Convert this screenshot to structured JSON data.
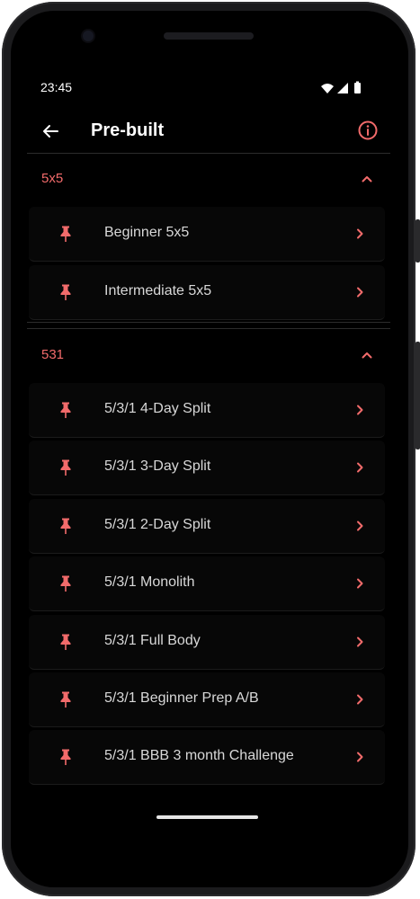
{
  "status": {
    "time": "23:45"
  },
  "appbar": {
    "title": "Pre-built"
  },
  "colors": {
    "accent": "#f26b6b",
    "background": "#000000",
    "text": "#d8d8d8"
  },
  "icons": {
    "back": "arrow-left-icon",
    "info": "info-icon",
    "pin": "pin-icon",
    "expand": "chevron-up-icon",
    "open": "chevron-right-icon"
  },
  "sections": [
    {
      "title": "5x5",
      "items": [
        {
          "label": "Beginner 5x5"
        },
        {
          "label": "Intermediate 5x5"
        }
      ]
    },
    {
      "title": "531",
      "items": [
        {
          "label": "5/3/1 4-Day Split"
        },
        {
          "label": "5/3/1 3-Day Split"
        },
        {
          "label": "5/3/1 2-Day Split"
        },
        {
          "label": "5/3/1 Monolith"
        },
        {
          "label": "5/3/1 Full Body"
        },
        {
          "label": "5/3/1 Beginner Prep A/B"
        },
        {
          "label": "5/3/1 BBB 3 month Challenge"
        }
      ]
    }
  ]
}
